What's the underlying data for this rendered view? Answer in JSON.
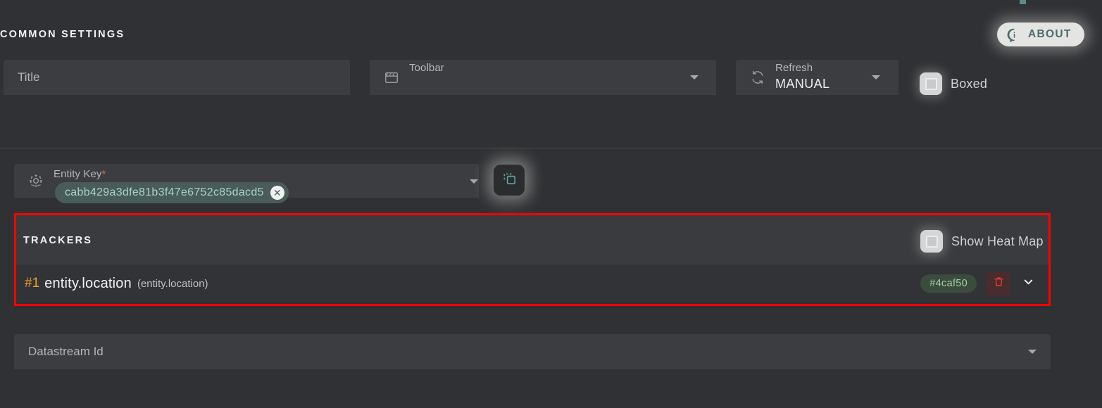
{
  "sections": {
    "common_settings_title": "COMMON SETTINGS",
    "trackers_title": "TRACKERS"
  },
  "about_button": {
    "label": "ABOUT",
    "icon": "info-icon",
    "background": "#e4e5e3",
    "text_color": "#4a6b6b"
  },
  "common_settings": {
    "title_field": {
      "placeholder": "Title",
      "value": ""
    },
    "toolbar_field": {
      "label": "Toolbar",
      "value": "",
      "icon": "window-icon",
      "caret": "chevron-down-icon"
    },
    "refresh_field": {
      "label": "Refresh",
      "value": "MANUAL",
      "icon": "refresh-icon",
      "caret": "chevron-down-icon"
    },
    "boxed_checkbox": {
      "label": "Boxed",
      "checked": false
    }
  },
  "entity": {
    "label": "Entity Key",
    "required_marker": "*",
    "icon": "target-icon",
    "chip_value": "cabb429a3dfe81b3f47e6752c85dacd5",
    "chip_remove_icon": "close-icon",
    "caret": "chevron-down-icon",
    "copy_button_icon": "copy-icon"
  },
  "trackers": {
    "heat_map_checkbox": {
      "label": "Show Heat Map",
      "checked": false
    },
    "highlight_border_color": "#fe0000",
    "rows": [
      {
        "index": "#1",
        "name": "entity.location",
        "source": "(entity.location)",
        "color": "#4caf50",
        "delete_icon": "trash-icon",
        "expand_icon": "chevron-down-icon"
      }
    ]
  },
  "datastream": {
    "placeholder": "Datastream Id",
    "value": "",
    "caret": "chevron-down-icon"
  }
}
